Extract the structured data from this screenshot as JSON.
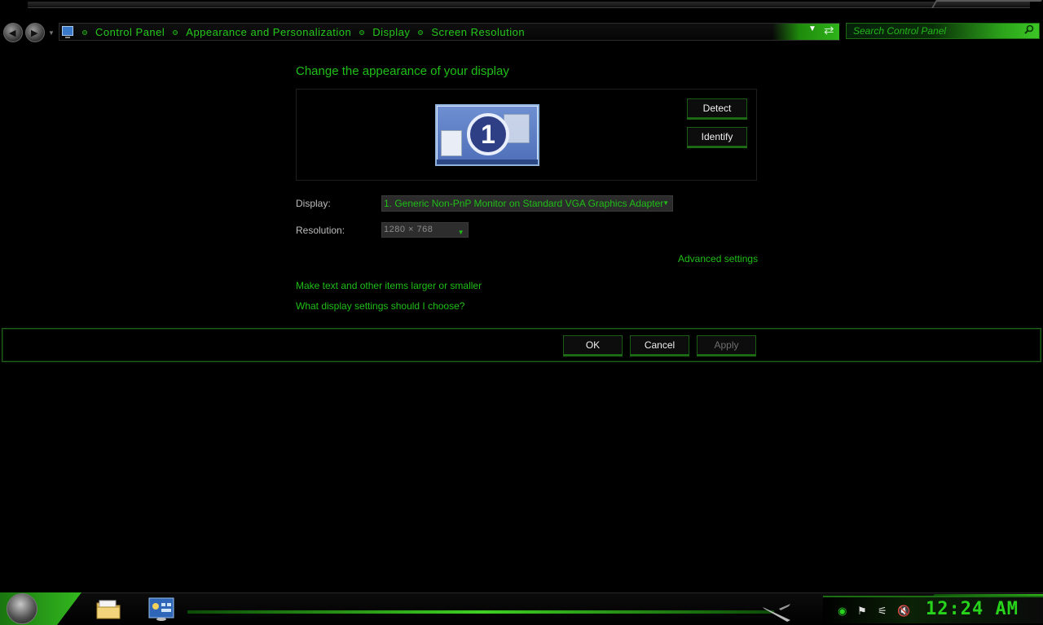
{
  "nav": {
    "back_icon": "back-arrow-icon",
    "forward_icon": "forward-arrow-icon",
    "breadcrumb": [
      "Control Panel",
      "Appearance and Personalization",
      "Display",
      "Screen Resolution"
    ],
    "search_placeholder": "Search Control Panel"
  },
  "page": {
    "title": "Change the appearance of your display",
    "monitor_number": "1",
    "detect_label": "Detect",
    "identify_label": "Identify",
    "display_label": "Display:",
    "display_value": "1. Generic Non-PnP Monitor on Standard VGA Graphics Adapter",
    "resolution_label": "Resolution:",
    "resolution_value": "1280 × 768",
    "advanced_link": "Advanced settings",
    "link_text_size": "Make text and other items larger or smaller",
    "link_help": "What display settings should I choose?"
  },
  "buttons": {
    "ok": "OK",
    "cancel": "Cancel",
    "apply": "Apply"
  },
  "taskbar": {
    "clock": "12:24 AM",
    "accent_color": "#27d41b"
  }
}
